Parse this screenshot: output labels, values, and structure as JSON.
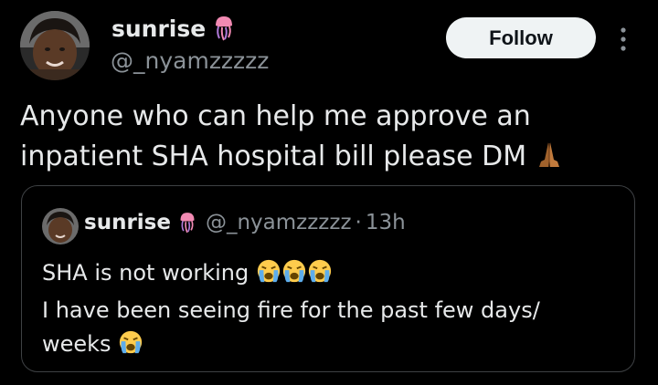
{
  "author": {
    "name": "sunrise",
    "handle": "@_nyamzzzzz",
    "name_emoji_icon": "jellyfish-emoji",
    "avatar_icon": "profile-avatar"
  },
  "actions": {
    "follow_label": "Follow",
    "more_icon": "more-vertical-icon"
  },
  "post": {
    "line1": "Anyone who can help me approve an",
    "line2": "inpatient SHA hospital bill please DM",
    "trailing_emoji_icon": "folded-hands-emoji"
  },
  "quote": {
    "name": "sunrise",
    "handle": "@_nyamzzzzz",
    "separator": "·",
    "time": "13h",
    "line1": "SHA is not working",
    "line1_emoji_icon": "loudly-crying-face-emoji",
    "line1_emoji_count": 3,
    "line2": "I have been seeing fire for the past few days/",
    "line3": "weeks",
    "line3_emoji_icon": "loudly-crying-face-emoji"
  },
  "colors": {
    "background": "#000000",
    "primary_text": "#e7e9ea",
    "secondary_text": "#8b9298",
    "button_bg": "#eff3f4",
    "button_text": "#0f1419",
    "card_border": "#3e4144"
  }
}
